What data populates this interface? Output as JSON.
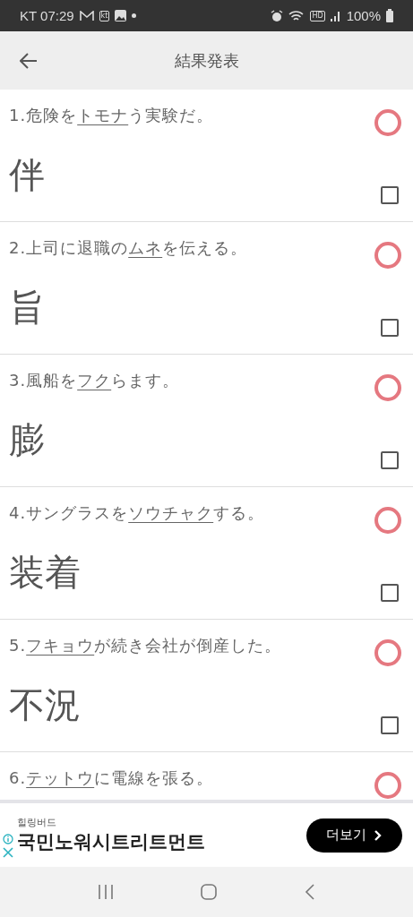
{
  "status_bar": {
    "carrier": "KT",
    "time": "07:29",
    "carrier_badge": "kt",
    "hd_badge": "HD",
    "battery": "100%"
  },
  "header": {
    "title": "結果発表"
  },
  "questions": [
    {
      "number": "1.",
      "before": "危険を",
      "underlined": "トモナ",
      "after": "う実験だ。",
      "answer": "伴",
      "correct": true,
      "checked": false
    },
    {
      "number": "2.",
      "before": "上司に退職の",
      "underlined": "ムネ",
      "after": "を伝える。",
      "answer": "旨",
      "correct": true,
      "checked": false
    },
    {
      "number": "3.",
      "before": "風船を",
      "underlined": "フク",
      "after": "らます。",
      "answer": "膨",
      "correct": true,
      "checked": false
    },
    {
      "number": "4.",
      "before": "サングラスを",
      "underlined": "ソウチャク",
      "after": "する。",
      "answer": "装着",
      "correct": true,
      "checked": false
    },
    {
      "number": "5.",
      "underlined": "フキョウ",
      "after": "が続き会社が倒産した。",
      "answer": "不況",
      "correct": true,
      "checked": false
    },
    {
      "number": "6.",
      "underlined": "テットウ",
      "after": "に電線を張る。",
      "correct": true
    }
  ],
  "ad": {
    "advertiser": "힐링버드",
    "headline": "국민노워시트리트먼트",
    "button": "더보기"
  }
}
